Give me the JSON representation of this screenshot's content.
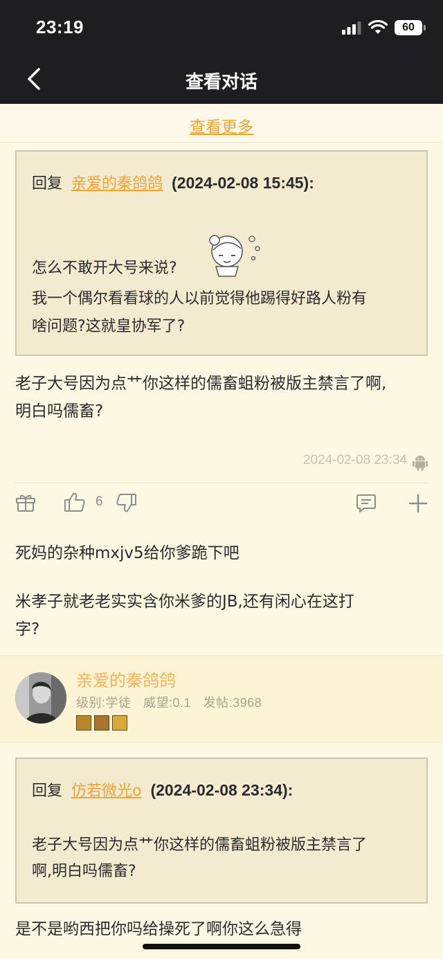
{
  "status_bar": {
    "time": "23:19",
    "battery": "60"
  },
  "nav": {
    "title": "查看对话"
  },
  "more": {
    "label": "查看更多"
  },
  "quote1": {
    "prefix": "回复",
    "user": "亲爱的秦鸽鸽",
    "date": "(2024-02-08 15:45):",
    "line1": "怎么不敢开大号来说?",
    "line2": "我一个偶尔看看球的人以前觉得他踢得好路人粉有",
    "line3": "啥问题?这就皇协军了?"
  },
  "post1": {
    "line1": "老子大号因为点艹你这样的儒畜蛆粉被版主禁言了啊,",
    "line2": "明白吗儒畜?",
    "time": "2024-02-08 23:34"
  },
  "actions": {
    "like_count": "6"
  },
  "post2": {
    "line1": "死妈的杂种mxjv5给你爹跪下吧",
    "line2": "米孝子就老老实实含你米爹的JB,还有闲心在这打",
    "line3": "字?"
  },
  "user": {
    "name": "亲爱的秦鸽鸽",
    "level": "级别:学徒",
    "prestige": "威望:0.1",
    "posts": "发帖:3968"
  },
  "quote2": {
    "prefix": "回复",
    "user": "仿若微光o",
    "date": "(2024-02-08 23:34):",
    "line1": "老子大号因为点艹你这样的儒畜蛆粉被版主禁言了",
    "line2": "啊,明白吗儒畜?"
  },
  "post3": {
    "line1": "是不是哟西把你吗给操死了啊你这么急得"
  },
  "colors": {
    "accent": "#f2a233",
    "nav_bg": "#1e1e22",
    "page_bg": "#fdf8e4",
    "quote_bg": "#f2ebcf"
  }
}
